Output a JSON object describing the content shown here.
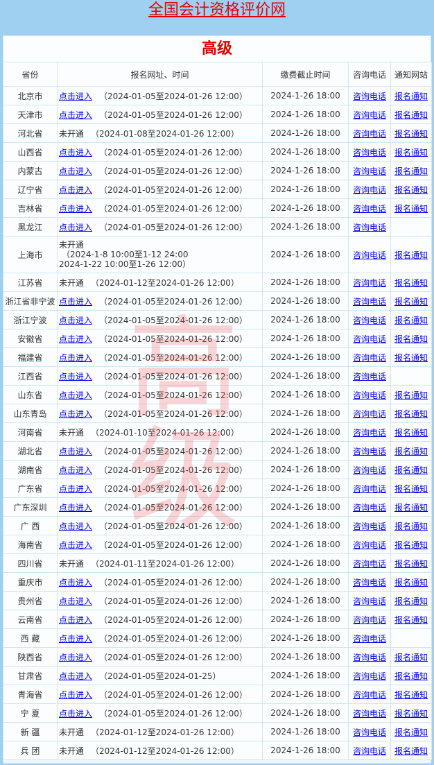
{
  "site": {
    "title": "全国会计资格评价网"
  },
  "level": "高级",
  "watermark": [
    "高",
    "级"
  ],
  "headers": {
    "province": "省份",
    "registration": "报名网址、时间",
    "deadline": "缴费截止时间",
    "phone": "咨询电话",
    "notice": "通知网站"
  },
  "rows": [
    {
      "province": "北京市",
      "link": "点击进入",
      "range": "（2024-01-05至2024-01-26 12:00）",
      "deadline": "2024-1-26 18:00",
      "phone": "咨询电话",
      "notice": "报名通知"
    },
    {
      "province": "天津市",
      "link": "点击进入",
      "range": "（2024-01-05至2024-01-26 12:00）",
      "deadline": "2024-1-26 18:00",
      "phone": "咨询电话",
      "notice": "报名通知"
    },
    {
      "province": "河北省",
      "status": "未开通",
      "range": "（2024-01-08至2024-01-26 12:00）",
      "deadline": "2024-1-26 18:00",
      "phone": "咨询电话",
      "notice": "报名通知"
    },
    {
      "province": "山西省",
      "link": "点击进入",
      "range": "（2024-01-05至2024-01-26 12:00）",
      "deadline": "2024-1-26 18:00",
      "phone": "咨询电话",
      "notice": "报名通知"
    },
    {
      "province": "内蒙古",
      "link": "点击进入",
      "range": "（2024-01-05至2024-01-26 12:00）",
      "deadline": "2024-1-26 18:00",
      "phone": "咨询电话",
      "notice": "报名通知"
    },
    {
      "province": "辽宁省",
      "link": "点击进入",
      "range": "（2024-01-05至2024-01-26 12:00）",
      "deadline": "2024-1-26 18:00",
      "phone": "咨询电话",
      "notice": "报名通知"
    },
    {
      "province": "吉林省",
      "link": "点击进入",
      "range": "（2024-01-05至2024-01-26 12:00）",
      "deadline": "2024-1-26 18:00",
      "phone": "咨询电话",
      "notice": "报名通知"
    },
    {
      "province": "黑龙江",
      "link": "点击进入",
      "range": "（2024-01-05至2024-01-26 12:00）",
      "deadline": "2024-1-26 18:00",
      "phone": "咨询电话",
      "notice": ""
    },
    {
      "province": "上海市",
      "status": "未开通",
      "line2": "（2024-1-8 10:00至1-12 24:00",
      "line3": "2024-1-22 10:00至1-26 12:00）",
      "deadline": "2024-1-26 18:00",
      "phone": "咨询电话",
      "notice": "报名通知"
    },
    {
      "province": "江苏省",
      "status": "未开通",
      "range": "（2024-01-12至2024-01-26 12:00）",
      "deadline": "2024-1-26 18:00",
      "phone": "咨询电话",
      "notice": "报名通知"
    },
    {
      "province": "浙江省非宁波",
      "link": "点击进入",
      "range": "（2024-01-05至2024-01-26 12:00）",
      "deadline": "2024-1-26 18:00",
      "phone": "咨询电话",
      "notice": "报名通知"
    },
    {
      "province": "浙江宁波",
      "link": "点击进入",
      "range": "（2024-01-05至2024-01-26 12:00）",
      "deadline": "2024-1-26 18:00",
      "phone": "咨询电话",
      "notice": "报名通知"
    },
    {
      "province": "安徽省",
      "link": "点击进入",
      "range": "（2024-01-05至2024-01-26 12:00）",
      "deadline": "2024-1-26 18:00",
      "phone": "咨询电话",
      "notice": "报名通知"
    },
    {
      "province": "福建省",
      "link": "点击进入",
      "range": "（2024-01-05至2024-01-26 12:00）",
      "deadline": "2024-1-26 18:00",
      "phone": "咨询电话",
      "notice": "报名通知"
    },
    {
      "province": "江西省",
      "link": "点击进入",
      "range": "（2024-01-05至2024-01-26 12:00）",
      "deadline": "2024-1-26 18:00",
      "phone": "咨询电话",
      "notice": ""
    },
    {
      "province": "山东省",
      "link": "点击进入",
      "range": "（2024-01-05至2024-01-26 12:00）",
      "deadline": "2024-1-26 18:00",
      "phone": "咨询电话",
      "notice": "报名通知"
    },
    {
      "province": "山东青岛",
      "link": "点击进入",
      "range": "（2024-01-05至2024-01-26 12:00）",
      "deadline": "2024-1-26 18:00",
      "phone": "咨询电话",
      "notice": "报名通知"
    },
    {
      "province": "河南省",
      "status": "未开通",
      "range": "（2024-01-10至2024-01-26 12:00）",
      "deadline": "2024-1-26 18:00",
      "phone": "咨询电话",
      "notice": "报名通知"
    },
    {
      "province": "湖北省",
      "link": "点击进入",
      "range": "（2024-01-05至2024-01-26 12:00）",
      "deadline": "2024-1-26 18:00",
      "phone": "咨询电话",
      "notice": "报名通知"
    },
    {
      "province": "湖南省",
      "link": "点击进入",
      "range": "（2024-01-05至2024-01-26 12:00）",
      "deadline": "2024-1-26 18:00",
      "phone": "咨询电话",
      "notice": "报名通知"
    },
    {
      "province": "广东省",
      "link": "点击进入",
      "range": "（2024-01-05至2024-01-26 12:00）",
      "deadline": "2024-1-26 18:00",
      "phone": "咨询电话",
      "notice": "报名通知"
    },
    {
      "province": "广东深圳",
      "link": "点击进入",
      "range": "（2024-01-05至2024-01-26 12:00）",
      "deadline": "2024-1-26 18:00",
      "phone": "咨询电话",
      "notice": "报名通知"
    },
    {
      "province": "广 西",
      "link": "点击进入",
      "range": "（2024-01-05至2024-01-26 12:00）",
      "deadline": "2024-1-26 18:00",
      "phone": "咨询电话",
      "notice": "报名通知"
    },
    {
      "province": "海南省",
      "link": "点击进入",
      "range": "（2024-01-05至2024-01-26 12:00）",
      "deadline": "2024-1-26 18:00",
      "phone": "咨询电话",
      "notice": "报名通知"
    },
    {
      "province": "四川省",
      "status": "未开通",
      "range": "（2024-01-11至2024-01-26 12:00）",
      "deadline": "2024-1-26 18:00",
      "phone": "咨询电话",
      "notice": "报名通知"
    },
    {
      "province": "重庆市",
      "link": "点击进入",
      "range": "（2024-01-05至2024-01-26 12:00）",
      "deadline": "2024-1-26 18:00",
      "phone": "咨询电话",
      "notice": "报名通知"
    },
    {
      "province": "贵州省",
      "link": "点击进入",
      "range": "（2024-01-05至2024-01-26 12:00）",
      "deadline": "2024-1-26 18:00",
      "phone": "咨询电话",
      "notice": "报名通知"
    },
    {
      "province": "云南省",
      "link": "点击进入",
      "range": "（2024-01-05至2024-01-26 12:00）",
      "deadline": "2024-1-26 18:00",
      "phone": "咨询电话",
      "notice": "报名通知"
    },
    {
      "province": "西 藏",
      "link": "点击进入",
      "range": "（2024-01-05至2024-01-26 12:00）",
      "deadline": "2024-1-26 18:00",
      "phone": "咨询电话",
      "notice": ""
    },
    {
      "province": "陕西省",
      "link": "点击进入",
      "range": "（2024-01-05至2024-01-26 12:00）",
      "deadline": "2024-1-26 18:00",
      "phone": "咨询电话",
      "notice": "报名通知"
    },
    {
      "province": "甘肃省",
      "link": "点击进入",
      "range": "（2024-01-05至2024-01-25）",
      "deadline": "2024-1-26 18:00",
      "phone": "咨询电话",
      "notice": "报名通知"
    },
    {
      "province": "青海省",
      "link": "点击进入",
      "range": "（2024-01-05至2024-01-26 12:00）",
      "deadline": "2024-1-26 18:00",
      "phone": "咨询电话",
      "notice": "报名通知"
    },
    {
      "province": "宁 夏",
      "link": "点击进入",
      "range": "（2024-01-05至2024-01-26 12:00）",
      "deadline": "2024-1-26 18:00",
      "phone": "咨询电话",
      "notice": "报名通知"
    },
    {
      "province": "新 疆",
      "status": "未开通",
      "range": "（2024-01-12至2024-01-26 12:00）",
      "deadline": "2024-1-26 18:00",
      "phone": "咨询电话",
      "notice": "报名通知"
    },
    {
      "province": "兵 团",
      "status": "未开通",
      "range": "（2024-01-12至2024-01-26 12:00）",
      "deadline": "2024-1-26 18:00",
      "phone": "咨询电话",
      "notice": "报名通知"
    }
  ]
}
